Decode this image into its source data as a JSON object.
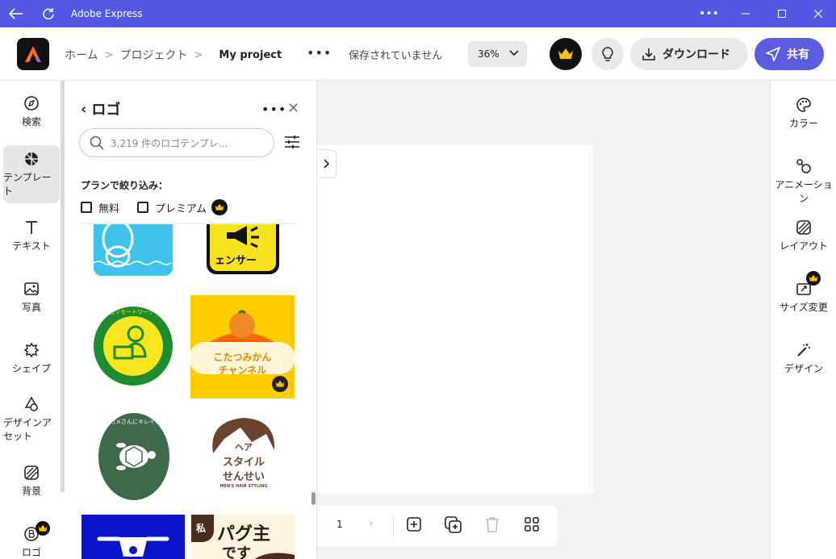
{
  "titlebar": {
    "title": "Adobe Express"
  },
  "header": {
    "breadcrumb": {
      "home": "ホーム",
      "projects": "プロジェクト",
      "project_name": "My project"
    },
    "save_status": "保存されていません",
    "zoom": "36%",
    "download_label": "ダウンロード",
    "share_label": "共有"
  },
  "left_rail": {
    "items": [
      {
        "label": "検索",
        "icon": "compass-icon"
      },
      {
        "label": "テンプレート",
        "icon": "templates-icon"
      },
      {
        "label": "テキスト",
        "icon": "text-icon"
      },
      {
        "label": "写真",
        "icon": "photo-icon"
      },
      {
        "label": "シェイプ",
        "icon": "shape-icon"
      },
      {
        "label": "デザインアセット",
        "icon": "design-assets-icon"
      },
      {
        "label": "背景",
        "icon": "background-icon"
      },
      {
        "label": "ロゴ",
        "icon": "brand-logo-icon"
      }
    ]
  },
  "panel": {
    "title": "ロゴ",
    "search_placeholder": "3,219 件のロゴテンプレ...",
    "filter_title": "プランで絞り込み：",
    "filter_free": "無料",
    "filter_premium": "プレミアム",
    "tiles": [
      {
        "name": "blue-mascot-logo",
        "color": "#3fc3ea"
      },
      {
        "name": "yellow-megaphone-logo",
        "text": "ェンサー",
        "color": "#f6e21e"
      },
      {
        "name": "remote-work-logo",
        "text": "毎日リモートワーク",
        "color": "#1e8c2e"
      },
      {
        "name": "kotatsu-mikan-logo",
        "text1": "こたつみかん",
        "text2": "チャンネル",
        "color": "#ffcc00"
      },
      {
        "name": "turtle-logo",
        "text": "ウミガメさんにキレイな砂浜を",
        "color": "#3e6a4a"
      },
      {
        "name": "hair-stylist-logo",
        "text1": "ヘア",
        "text2": "スタイル",
        "text3": "せんせい",
        "text4": "MEN'S HAIR STYLING",
        "color": "#6b4431"
      },
      {
        "name": "drone-logo",
        "color": "#0a14c8"
      },
      {
        "name": "pug-logo",
        "text1": "パグ主",
        "text2": "です",
        "badge": "私",
        "color": "#fff3e0"
      }
    ]
  },
  "canvas": {
    "page_number": "1"
  },
  "right_rail": {
    "items": [
      {
        "label": "カラー",
        "icon": "palette-icon"
      },
      {
        "label": "アニメーション",
        "icon": "animation-icon"
      },
      {
        "label": "レイアウト",
        "icon": "layout-icon"
      },
      {
        "label": "サイズ変更",
        "icon": "resize-icon"
      },
      {
        "label": "デザイン",
        "icon": "magic-wand-icon"
      }
    ]
  },
  "colors": {
    "accent": "#5c5ce0",
    "titlebar": "#5258e4",
    "crown": "#f5c400"
  }
}
